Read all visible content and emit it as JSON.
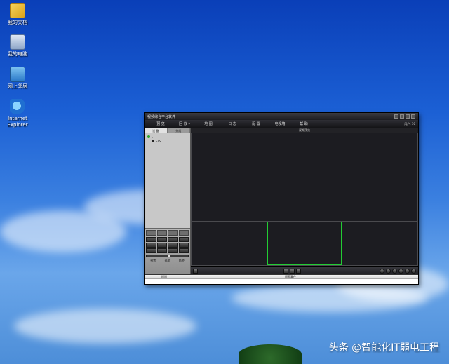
{
  "desktop": {
    "icons": [
      {
        "label": "我的文档",
        "icon": "my-documents-icon"
      },
      {
        "label": "我的电脑",
        "icon": "my-computer-icon"
      },
      {
        "label": "网上邻居",
        "icon": "network-places-icon"
      },
      {
        "label": "Internet Explorer",
        "icon": "internet-explorer-icon"
      }
    ],
    "watermark": "头条 @智能化IT弱电工程"
  },
  "window": {
    "title": "视频综合平台软件",
    "user_label": "用户: 30",
    "menu": [
      "预 览",
      "回 放 ▾",
      "地 图",
      "日 志",
      "配 置",
      "电视墙",
      "帮 助"
    ],
    "left_tabs": [
      "设 备",
      "分组"
    ],
    "tree": {
      "root": "▸",
      "child": "ETS"
    },
    "view_title": "视频预览",
    "ptz_labels": [
      "预置",
      "巡航",
      "轨迹"
    ],
    "bottom_columns": [
      "时间",
      "报警事件"
    ],
    "selected_cell": 8
  },
  "colors": {
    "selected_cell_border": "#22cc33",
    "window_bg": "#1a1a1e"
  }
}
